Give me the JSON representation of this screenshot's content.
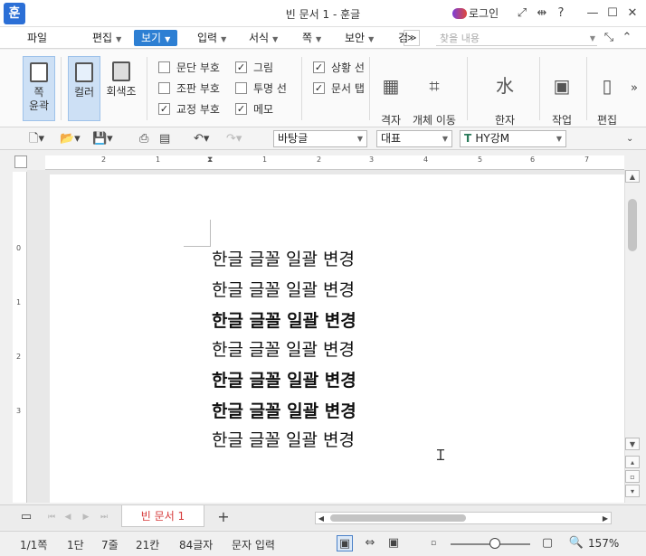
{
  "titlebar": {
    "app_logo": "훈",
    "title": "빈 문서 1 - 훈글",
    "login_label": "로그인",
    "help_label": "?"
  },
  "menubar": {
    "items": [
      {
        "label": "파일"
      },
      {
        "label": "편집"
      },
      {
        "label": "보기"
      },
      {
        "label": "입력"
      },
      {
        "label": "서식"
      },
      {
        "label": "쪽"
      },
      {
        "label": "보안"
      },
      {
        "label": "검"
      }
    ],
    "more_label": "≫",
    "find_placeholder": "찾을 내용"
  },
  "ribbon": {
    "page_outline": "쪽\n윤곽",
    "color": "컬러",
    "grayscale": "회색조",
    "checks": [
      {
        "label": "문단 부호",
        "checked": false
      },
      {
        "label": "조판 부호",
        "checked": false
      },
      {
        "label": "교정 부호",
        "checked": true
      },
      {
        "label": "그림",
        "checked": true
      },
      {
        "label": "투명 선",
        "checked": false
      },
      {
        "label": "메모",
        "checked": true
      },
      {
        "label": "상황 선",
        "checked": true
      },
      {
        "label": "문서 탭",
        "checked": true
      }
    ],
    "grid": "격자",
    "object_move": "개체 이동\n안내선",
    "hanja": "한자\n발음 표시",
    "work_window": "작업\n창",
    "edit_split": "편집\n나누"
  },
  "toolbar": {
    "style": "바탕글",
    "font_lang": "대표",
    "font_name": "HY강M"
  },
  "document": {
    "lines": [
      {
        "text": "한글 글꼴 일괄 변경",
        "bold": false
      },
      {
        "text": "한글 글꼴 일괄 변경",
        "bold": false
      },
      {
        "text": "한글 글꼴 일괄 변경",
        "bold": true
      },
      {
        "text": "한글 글꼴 일괄 변경",
        "bold": false
      },
      {
        "text": "한글 글꼴 일괄 변경",
        "bold": true
      },
      {
        "text": "한글 글꼴 일괄 변경",
        "bold": true
      },
      {
        "text": "한글 글꼴 일괄 변경",
        "bold": false
      }
    ]
  },
  "ruler": {
    "h_numbers": [
      "2",
      "1",
      "1",
      "2",
      "3",
      "4",
      "5",
      "6",
      "7"
    ],
    "v_numbers": [
      "0",
      "1",
      "2",
      "3"
    ]
  },
  "tabs": {
    "doc_tab": "빈 문서 1",
    "add_label": "+"
  },
  "statusbar": {
    "page": "1/1쪽",
    "column": "1단",
    "line": "7줄",
    "col": "21칸",
    "chars": "84글자",
    "mode": "문자 입력",
    "zoom": "157%",
    "zoom_level": 0.5
  }
}
